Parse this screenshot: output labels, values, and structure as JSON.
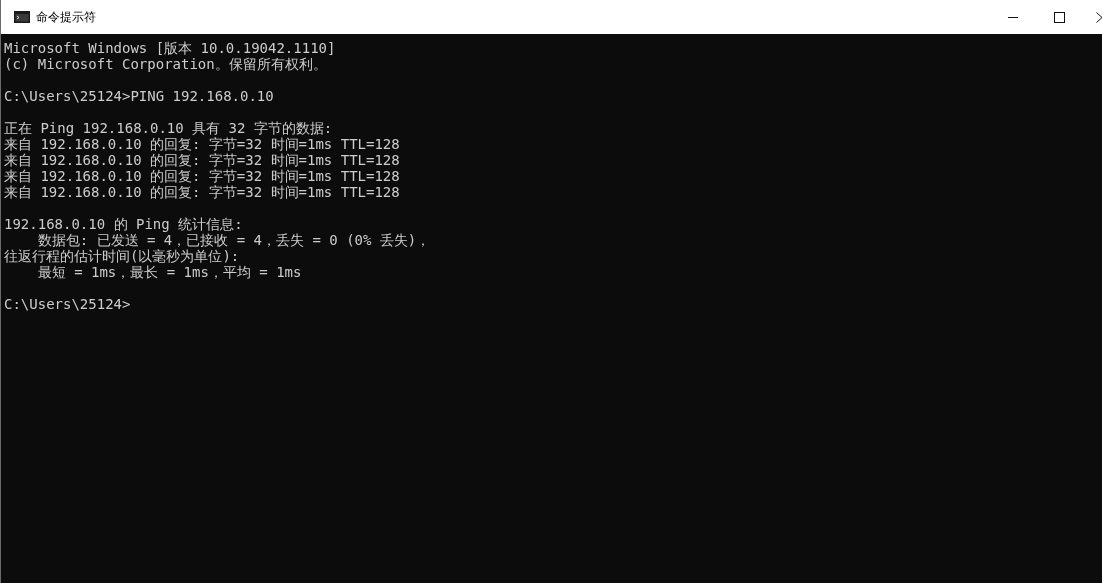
{
  "window": {
    "title": "命令提示符"
  },
  "console": {
    "groups": [
      {
        "lines": [
          "Microsoft Windows [版本 10.0.19042.1110]",
          "(c) Microsoft Corporation。保留所有权利。"
        ]
      },
      {
        "lines": [
          "C:\\Users\\25124>PING 192.168.0.10"
        ]
      },
      {
        "lines": [
          "正在 Ping 192.168.0.10 具有 32 字节的数据:",
          "来自 192.168.0.10 的回复: 字节=32 时间=1ms TTL=128",
          "来自 192.168.0.10 的回复: 字节=32 时间=1ms TTL=128",
          "来自 192.168.0.10 的回复: 字节=32 时间=1ms TTL=128",
          "来自 192.168.0.10 的回复: 字节=32 时间=1ms TTL=128"
        ]
      },
      {
        "lines": [
          "192.168.0.10 的 Ping 统计信息:",
          "    数据包: 已发送 = 4，已接收 = 4，丢失 = 0 (0% 丢失)，",
          "往返行程的估计时间(以毫秒为单位):",
          "    最短 = 1ms，最长 = 1ms，平均 = 1ms"
        ]
      },
      {
        "lines": [
          "C:\\Users\\25124>"
        ]
      }
    ]
  }
}
